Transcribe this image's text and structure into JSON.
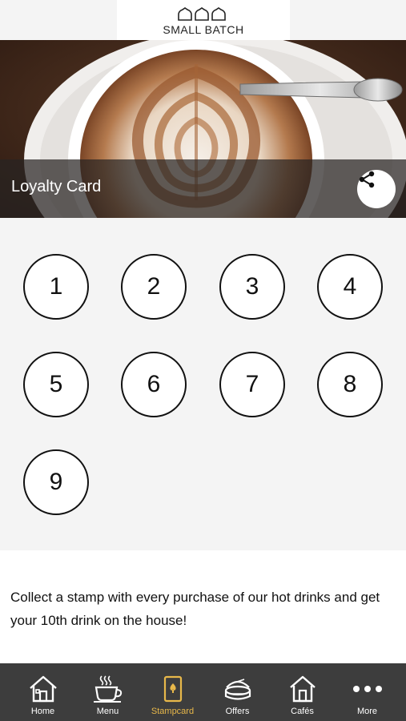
{
  "header": {
    "logo_text": "SMALL BATCH"
  },
  "hero": {
    "title": "Loyalty Card"
  },
  "stamps": [
    "1",
    "2",
    "3",
    "4",
    "5",
    "6",
    "7",
    "8",
    "9"
  ],
  "description": "Collect a stamp with every purchase of our hot drinks and get your 10th drink on the house!",
  "nav": {
    "items": [
      {
        "label": "Home",
        "icon": "home-icon"
      },
      {
        "label": "Menu",
        "icon": "coffee-cup-icon"
      },
      {
        "label": "Stampcard",
        "icon": "stampcard-icon",
        "active": true
      },
      {
        "label": "Offers",
        "icon": "offers-icon"
      },
      {
        "label": "Cafés",
        "icon": "cafe-building-icon"
      },
      {
        "label": "More",
        "icon": "more-dots-icon"
      }
    ]
  },
  "colors": {
    "nav_bg": "#3d3d3d",
    "active": "#e8b84a",
    "stamp_border": "#111111"
  }
}
